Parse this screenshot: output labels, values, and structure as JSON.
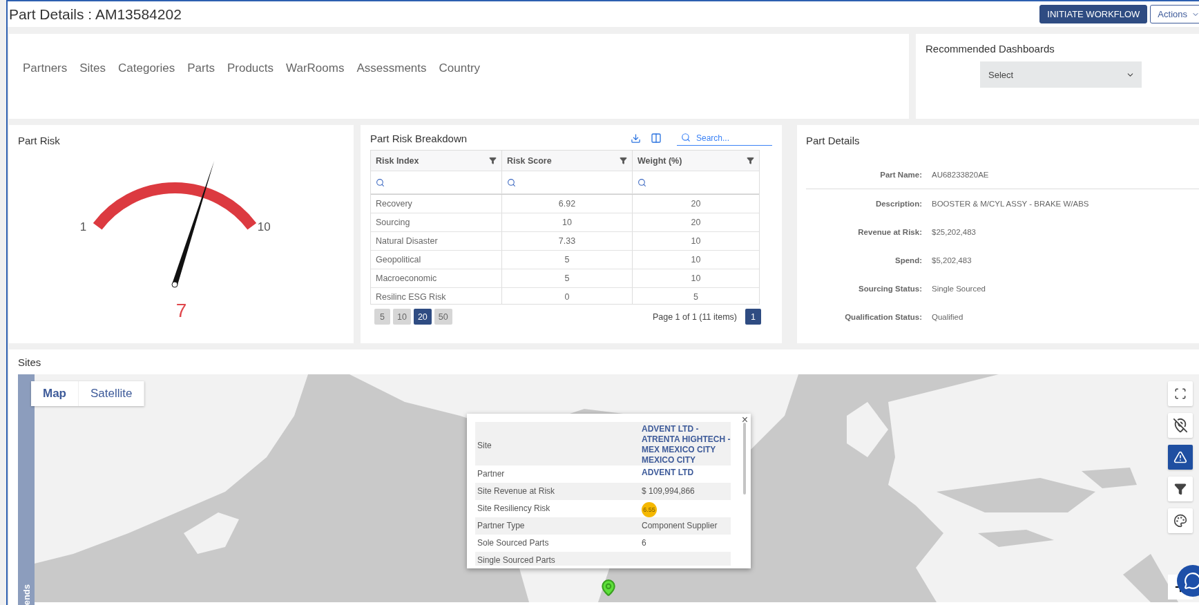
{
  "header": {
    "title": "Part Details : AM13584202",
    "buttons": [
      {
        "label": "INITIATE WORKFLOW",
        "kind": "primary"
      },
      {
        "label": "Actions",
        "kind": "dropdown"
      }
    ]
  },
  "nav": {
    "links": [
      "Partners",
      "Sites",
      "Categories",
      "Parts",
      "Products",
      "WarRooms",
      "Assessments",
      "Country"
    ]
  },
  "recommended": {
    "title": "Recommended Dashboards",
    "select": "Select"
  },
  "part_risk": {
    "title": "Part Risk",
    "min": "1",
    "max": "10",
    "value": "7",
    "level": 0.667
  },
  "breakdown": {
    "title": "Part Risk Breakdown",
    "search": {
      "placeholder": "Search..."
    },
    "columns": [
      "Risk Index",
      "Risk Score",
      "Weight (%)"
    ],
    "rows": [
      [
        "Recovery",
        "6.92",
        "20"
      ],
      [
        "Sourcing",
        "10",
        "20"
      ],
      [
        "Natural Disaster",
        "7.33",
        "10"
      ],
      [
        "Geopolitical",
        "5",
        "10"
      ],
      [
        "Macroeconomic",
        "5",
        "10"
      ],
      [
        "Resilinc ESG Risk",
        "0",
        "5"
      ]
    ],
    "page_sizes": [
      {
        "label": "5",
        "selected": false
      },
      {
        "label": "10",
        "selected": false
      },
      {
        "label": "20",
        "selected": true
      },
      {
        "label": "50",
        "selected": false
      }
    ],
    "page_info": "Page 1 of 1 (11 items)",
    "pages": [
      {
        "label": "1",
        "selected": true
      }
    ]
  },
  "part_details": {
    "title": "Part Details",
    "fields": [
      {
        "label": "Part Name:",
        "value": "AU68233820AE"
      },
      {
        "label": "Description:",
        "value": "BOOSTER & M/CYL ASSY - BRAKE W/ABS"
      },
      {
        "label": "Revenue at Risk:",
        "value": "$25,202,483"
      },
      {
        "label": "Spend:",
        "value": "$5,202,483"
      },
      {
        "label": "Sourcing Status:",
        "value": "Single Sourced"
      },
      {
        "label": "Qualification Status:",
        "value": "Qualified"
      }
    ]
  },
  "sites": {
    "title": "Sites",
    "map_types": [
      {
        "label": "Map",
        "selected": true
      },
      {
        "label": "Satellite",
        "selected": false
      }
    ],
    "legend_tab": "ends",
    "popup": {
      "close": "×",
      "rows": [
        {
          "label": "Site",
          "value": "ADVENT LTD - ATRENTA HIGHTECH - MEX MEXICO CITY MEXICO CITY",
          "kind": "link"
        },
        {
          "label": "Partner",
          "value": "ADVENT LTD",
          "kind": "link"
        },
        {
          "label": "Site Revenue at Risk",
          "value": "$ 109,994,866",
          "kind": "text"
        },
        {
          "label": "Site Resiliency Risk",
          "value": "6.55",
          "kind": "badge"
        },
        {
          "label": "Partner Type",
          "value": "Component Supplier",
          "kind": "text"
        },
        {
          "label": "Sole Sourced Parts",
          "value": "6",
          "kind": "text"
        },
        {
          "label": "Single Sourced Parts",
          "kind": "text"
        }
      ]
    },
    "tools": [
      {
        "kind": "fullscreen",
        "selected": false
      },
      {
        "kind": "pin-off",
        "selected": false
      },
      {
        "kind": "warning",
        "selected": true
      },
      {
        "kind": "filter",
        "selected": false
      },
      {
        "kind": "palette",
        "selected": false
      }
    ]
  }
}
